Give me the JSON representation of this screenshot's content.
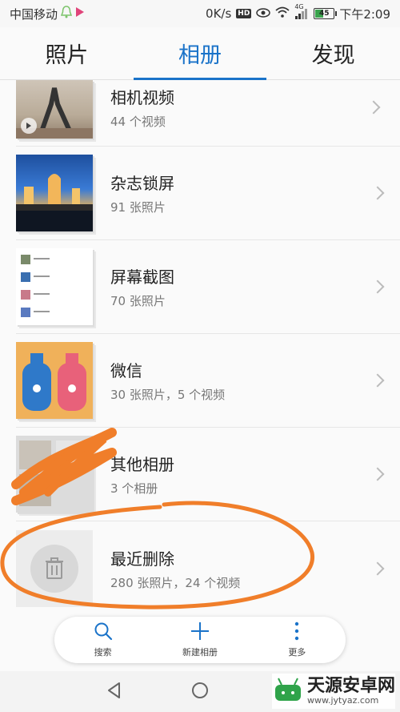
{
  "status_bar": {
    "carrier": "中国移动",
    "net_speed": "0K/s",
    "network_type": "4G",
    "battery_level": "45",
    "time": "下午2:09",
    "icons": [
      "notification-bell-icon",
      "play-icon",
      "hd-icon",
      "eye-icon",
      "wifi-icon",
      "signal-icon",
      "battery-icon"
    ]
  },
  "tabs": [
    {
      "label": "照片",
      "active": false
    },
    {
      "label": "相册",
      "active": true
    },
    {
      "label": "发现",
      "active": false
    }
  ],
  "albums": [
    {
      "name": "相机视频",
      "count": "44 个视频",
      "thumb": "video-thumbnail"
    },
    {
      "name": "杂志锁屏",
      "count": "91 张照片",
      "thumb": "magazine-thumbnail"
    },
    {
      "name": "屏幕截图",
      "count": "70 张照片",
      "thumb": "screenshot-thumbnail"
    },
    {
      "name": "微信",
      "count": "30 张照片，5 个视频",
      "thumb": "wechat-thumbnail"
    },
    {
      "name": "其他相册",
      "count": "3 个相册",
      "thumb": "other-thumbnail"
    },
    {
      "name": "最近删除",
      "count": "280 张照片，24 个视频",
      "thumb": "trash-icon"
    }
  ],
  "toolbar": {
    "search_label": "搜索",
    "new_album_label": "新建相册",
    "more_label": "更多"
  },
  "watermark": {
    "title": "天源安卓网",
    "url": "www.jytyaz.com"
  },
  "colors": {
    "accent": "#1a73c9",
    "annotation": "#f07e2a",
    "battery": "#3aa34d"
  }
}
